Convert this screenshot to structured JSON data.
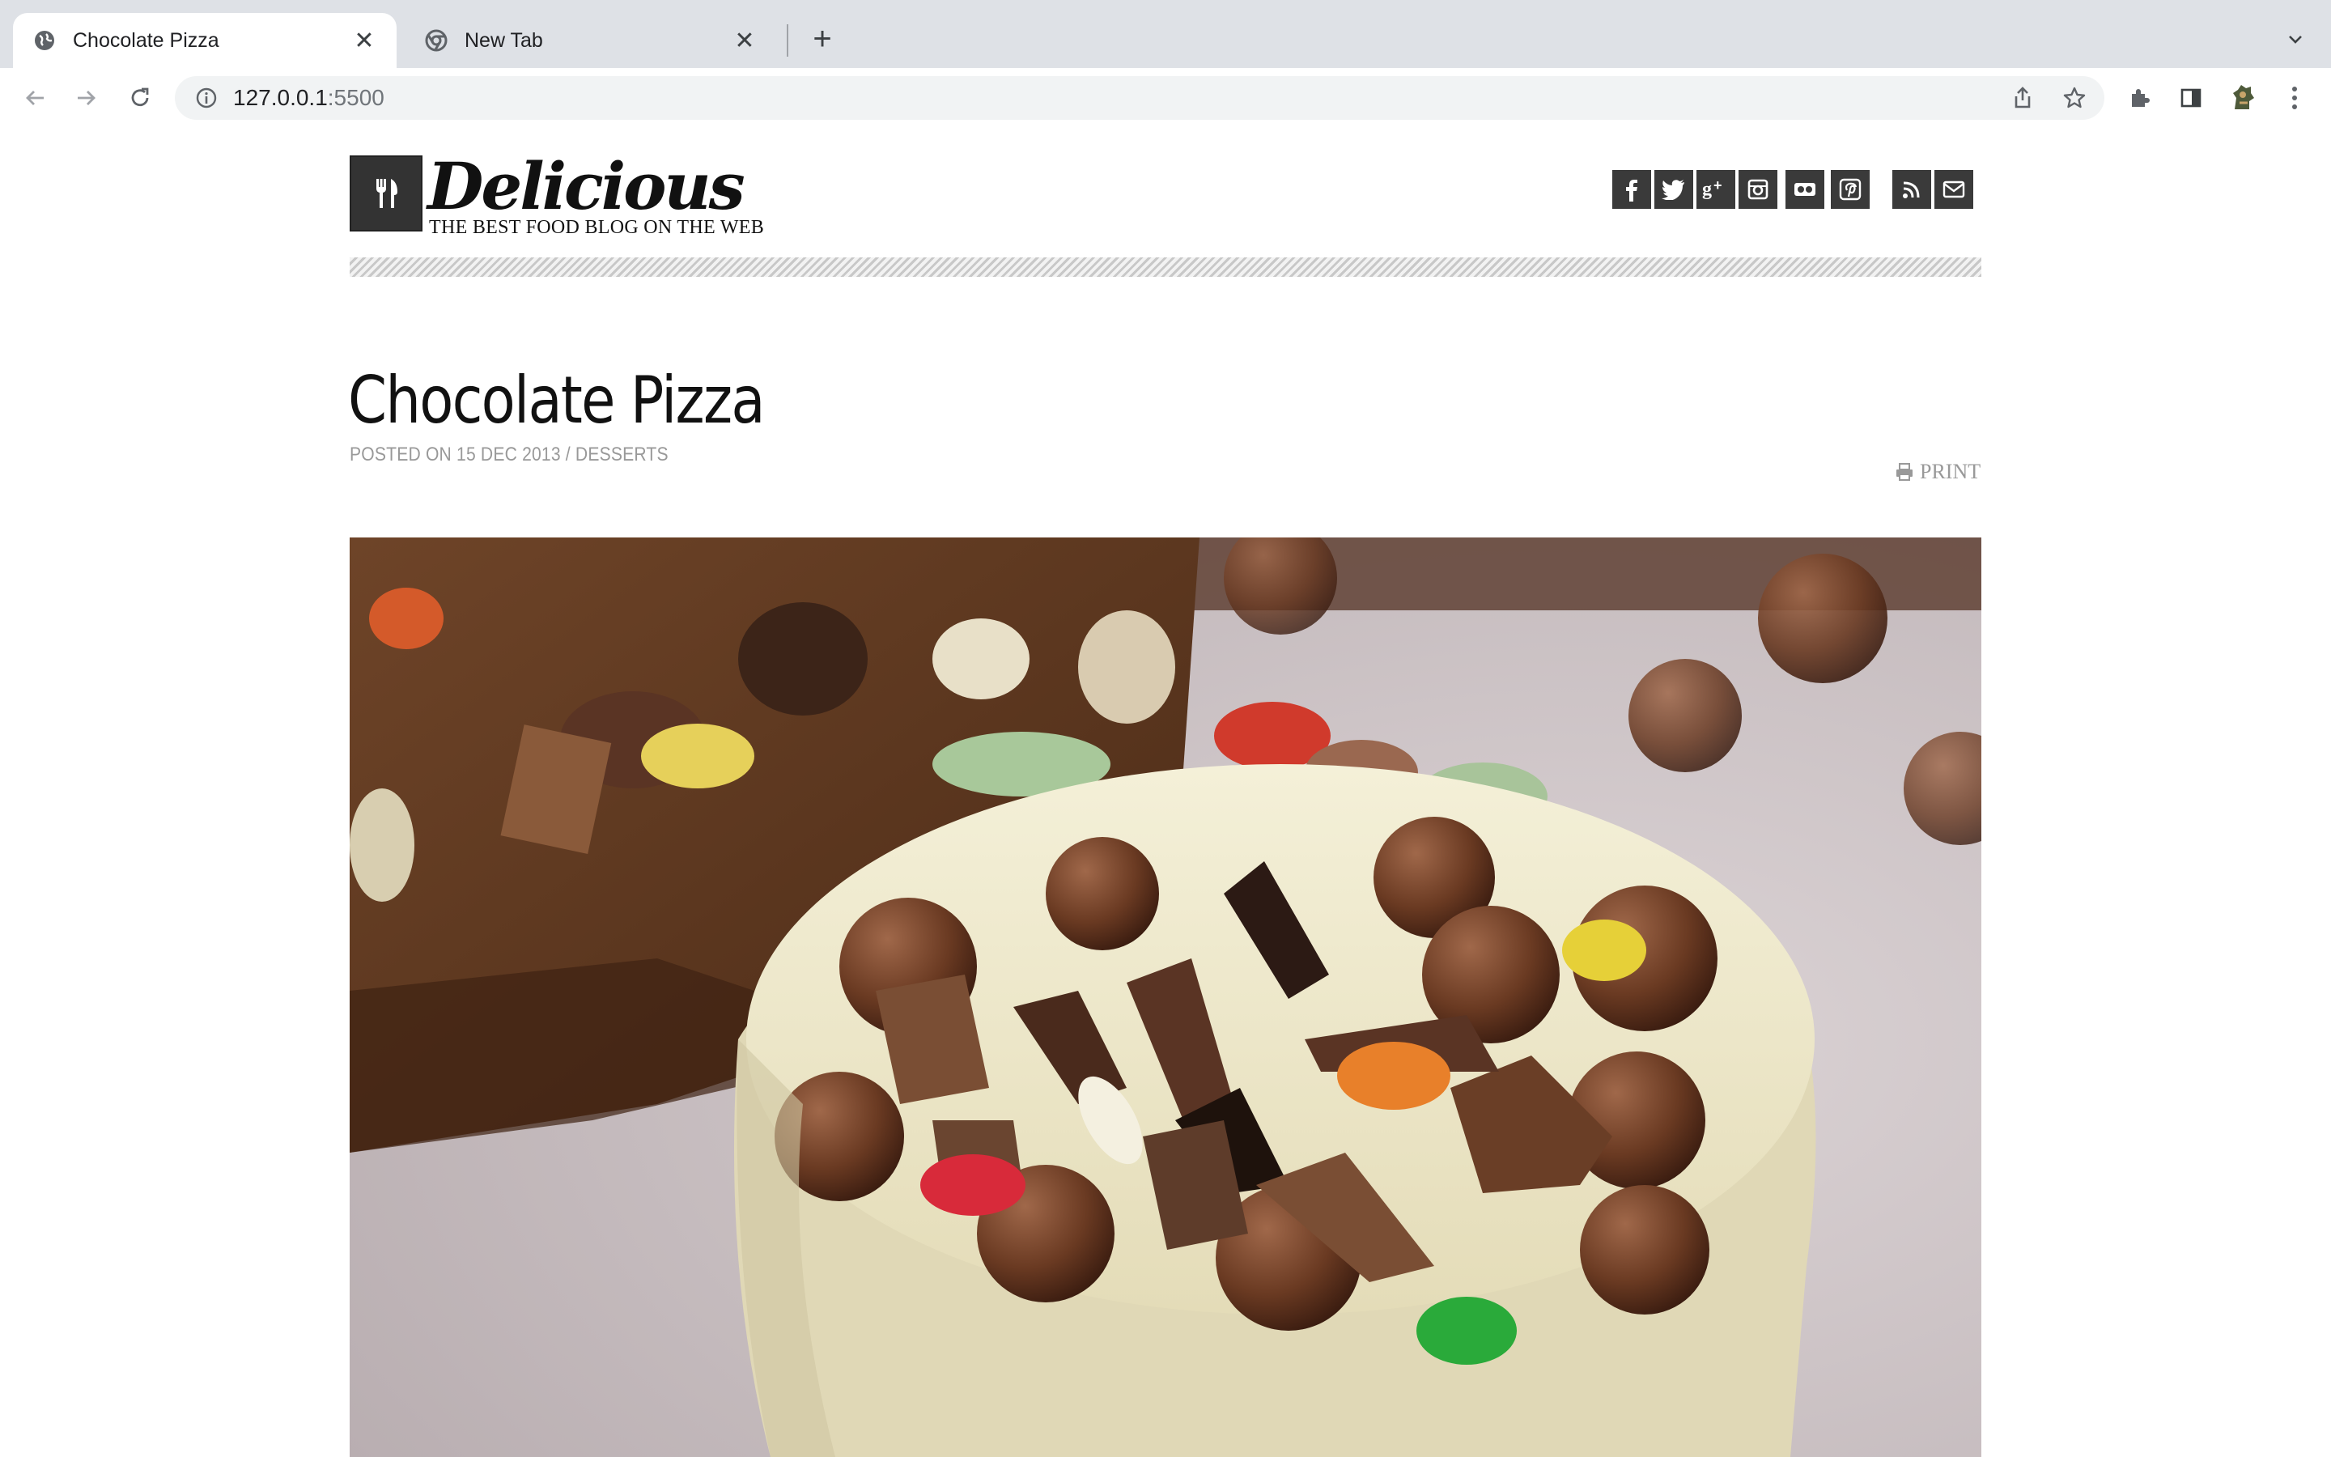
{
  "browser": {
    "tabs": [
      {
        "title": "Chocolate Pizza",
        "favicon": "globe-icon",
        "active": true
      },
      {
        "title": "New Tab",
        "favicon": "chrome-icon",
        "active": false
      }
    ],
    "url_host": "127.0.0.1",
    "url_port": ":5500"
  },
  "site": {
    "logo_name": "Delicious",
    "logo_tagline": "THE BEST FOOD BLOG ON THE WEB",
    "social": [
      {
        "name": "facebook-icon",
        "glyph": "f"
      },
      {
        "name": "twitter-icon",
        "glyph": "t"
      },
      {
        "name": "googleplus-icon",
        "glyph": "g+"
      },
      {
        "name": "instagram-icon",
        "glyph": ""
      },
      {
        "name": "flickr-icon",
        "glyph": ""
      },
      {
        "name": "pinterest-icon",
        "glyph": "p"
      },
      {
        "name": "rss-icon",
        "glyph": ""
      },
      {
        "name": "email-icon",
        "glyph": ""
      }
    ]
  },
  "post": {
    "title": "Chocolate Pizza",
    "meta": "POSTED ON 15 DEC 2013 / DESSERTS",
    "print_label": "PRINT"
  },
  "colors": {
    "tabbar": "#dee1e6",
    "social_bg": "#3a3a3a",
    "meta_gray": "#999999"
  }
}
